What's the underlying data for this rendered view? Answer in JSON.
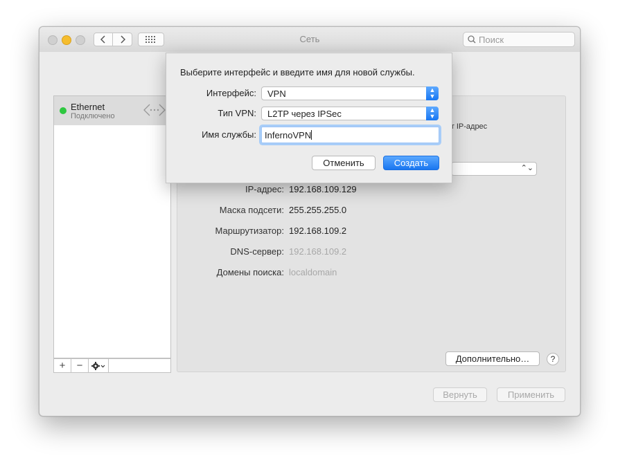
{
  "window": {
    "title": "Сеть",
    "search_placeholder": "Поиск"
  },
  "sidebar": {
    "items": [
      {
        "name": "Ethernet",
        "status": "Подключено",
        "status_color": "#2ec840",
        "icon": "ethernet-arrows-icon"
      }
    ],
    "add_label": "+",
    "remove_label": "−"
  },
  "panel": {
    "partial_text": "ет IP-адрес",
    "rows": [
      {
        "label": "IP-адрес:",
        "value": "192.168.109.129"
      },
      {
        "label": "Маска подсети:",
        "value": "255.255.255.0"
      },
      {
        "label": "Маршрутизатор:",
        "value": "192.168.109.2"
      },
      {
        "label": "DNS-сервер:",
        "value": "192.168.109.2"
      },
      {
        "label": "Домены поиска:",
        "value": "localdomain"
      }
    ],
    "advanced_label": "Дополнительно…",
    "help_label": "?"
  },
  "footer": {
    "revert_label": "Вернуть",
    "apply_label": "Применить"
  },
  "sheet": {
    "prompt": "Выберите интерфейс и введите имя для новой службы.",
    "interface_label": "Интерфейс:",
    "interface_value": "VPN",
    "vpn_type_label": "Тип VPN:",
    "vpn_type_value": "L2TP через IPSec",
    "service_name_label": "Имя службы:",
    "service_name_value": "InfernoVPN",
    "cancel_label": "Отменить",
    "create_label": "Создать"
  },
  "colors": {
    "accent": "#1976f0",
    "traffic_yellow": "#f5bd2e"
  }
}
